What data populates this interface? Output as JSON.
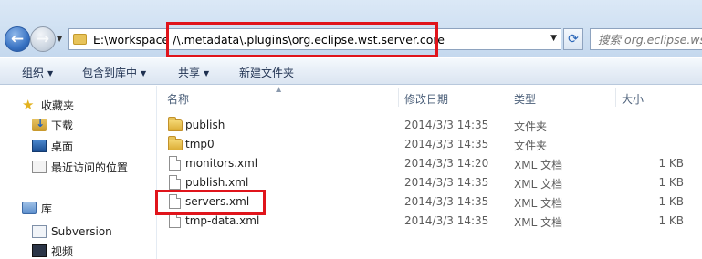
{
  "address_bar": {
    "path": "E:\\workspace /\\.metadata\\.plugins\\org.eclipse.wst.server.core",
    "search_placeholder": "搜索 org.eclipse.wst..."
  },
  "toolbar": {
    "organize": "组织",
    "include_in_library": "包含到库中",
    "share": "共享",
    "new_folder": "新建文件夹"
  },
  "nav_pane": {
    "favorites_label": "收藏夹",
    "favorites": [
      {
        "label": "下载",
        "icon": "download-folder-icon"
      },
      {
        "label": "桌面",
        "icon": "desktop-icon"
      },
      {
        "label": "最近访问的位置",
        "icon": "recent-places-icon"
      }
    ],
    "libraries_label": "库",
    "libraries": [
      {
        "label": "Subversion",
        "icon": "svn-library-icon"
      },
      {
        "label": "视频",
        "icon": "video-library-icon"
      }
    ]
  },
  "file_list": {
    "columns": {
      "name": "名称",
      "date": "修改日期",
      "type": "类型",
      "size": "大小"
    },
    "rows": [
      {
        "name": "publish",
        "date": "2014/3/3 14:35",
        "type": "文件夹",
        "size": "",
        "icon": "folder-icon"
      },
      {
        "name": "tmp0",
        "date": "2014/3/3 14:35",
        "type": "文件夹",
        "size": "",
        "icon": "folder-icon"
      },
      {
        "name": "monitors.xml",
        "date": "2014/3/3 14:20",
        "type": "XML 文档",
        "size": "1 KB",
        "icon": "xml-file-icon"
      },
      {
        "name": "publish.xml",
        "date": "2014/3/3 14:35",
        "type": "XML 文档",
        "size": "1 KB",
        "icon": "xml-file-icon"
      },
      {
        "name": "servers.xml",
        "date": "2014/3/3 14:35",
        "type": "XML 文档",
        "size": "1 KB",
        "icon": "xml-file-icon"
      },
      {
        "name": "tmp-data.xml",
        "date": "2014/3/3 14:35",
        "type": "XML 文档",
        "size": "1 KB",
        "icon": "xml-file-icon"
      }
    ]
  },
  "colors": {
    "highlight_box": "#e0141b",
    "folder": "#e7c35a",
    "address_strip": "#cfe0f2"
  }
}
